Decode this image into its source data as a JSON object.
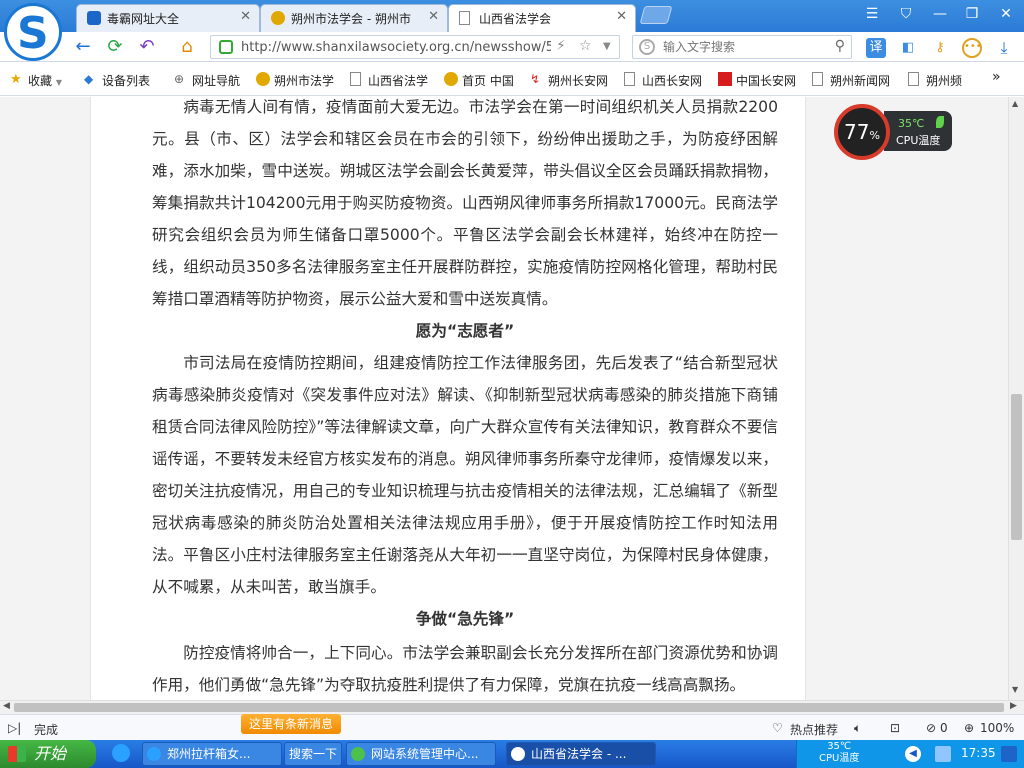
{
  "browser": {
    "tabs": [
      {
        "label": "毒霸网址大全",
        "active": false
      },
      {
        "label": "朔州市法学会 - 朔州市法学会",
        "active": false
      },
      {
        "label": "山西省法学会",
        "active": true
      }
    ],
    "url": "http://www.shanxilawsociety.org.cn/newsshow/58",
    "search_placeholder": "输入文字搜索",
    "bookmarks": [
      "收藏",
      "设备列表",
      "网址导航",
      "朔州市法学",
      "山西省法学",
      "首页 中国",
      "朔州长安网",
      "山西长安网",
      "中国长安网",
      "朔州新闻网",
      "朔州频"
    ]
  },
  "article": {
    "p1": "病毒无情人间有情，疫情面前大爱无边。市法学会在第一时间组织机关人员捐款2200元。县（市、区）法学会和辖区会员在市会的引领下，纷纷伸出援助之手，为防疫纾困解难，添水加柴，雪中送炭。朔城区法学会副会长黄爱萍，带头倡议全区会员踊跃捐款捐物，筹集捐款共计104200元用于购买防疫物资。山西朔风律师事务所捐款17000元。民商法学研究会组织会员为师生储备口罩5000个。平鲁区法学会副会长林建祥，始终冲在防控一线，组织动员350多名法律服务室主任开展群防群控，实施疫情防控网格化管理，帮助村民筹措口罩酒精等防护物资，展示公益大爱和雪中送炭真情。",
    "h2": "愿为“志愿者”",
    "p2": "市司法局在疫情防控期间，组建疫情防控工作法律服务团，先后发表了“结合新型冠状病毒感染肺炎疫情对《突发事件应对法》解读、《抑制新型冠状病毒感染的肺炎措施下商铺租赁合同法律风险防控》”等法律解读文章，向广大群众宣传有关法律知识，教育群众不要信谣传谣，不要转发未经官方核实发布的消息。朔风律师事务所秦守龙律师，疫情爆发以来，密切关注抗疫情况，用自己的专业知识梳理与抗击疫情相关的法律法规，汇总编辑了《新型冠状病毒感染的肺炎防治处置相关法律法规应用手册》，便于开展疫情防控工作时知法用法。平鲁区小庄村法律服务室主任谢落尧从大年初一一直坚守岗位，为保障村民身体健康，从不喊累，从未叫苦，敢当旗手。",
    "h3": "争做“急先锋”",
    "p3": "防控疫情将帅合一，上下同心。市法学会兼职副会长充分发挥所在部门资源优势和协调作用，他们勇做“急先锋”为夺取抗疫胜利提供了有力保障，党旗在抗疫一线高高飘扬。"
  },
  "cpu_widget": {
    "usage": "77",
    "unit": "%",
    "temp": "35℃",
    "label": "CPU温度"
  },
  "status": {
    "done": "完成",
    "new_msg": "这里有条新消息",
    "hot": "热点推荐",
    "count": "0",
    "zoom": "100%"
  },
  "taskbar": {
    "start": "开始",
    "items": [
      "郑州拉杆箱女...",
      "搜索一下",
      "网站系统管理中心...",
      "山西省法学会 - ..."
    ],
    "tray_temp": "35℃",
    "tray_label": "CPU温度",
    "clock": "17:35"
  }
}
